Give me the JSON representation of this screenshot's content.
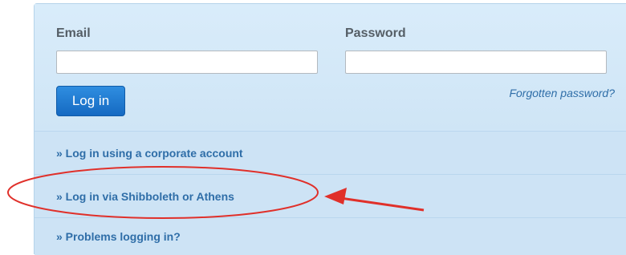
{
  "login": {
    "email_label": "Email",
    "password_label": "Password",
    "email_value": "",
    "password_value": "",
    "login_button": "Log in",
    "forgot_password": "Forgotten password?"
  },
  "options": [
    {
      "label": "» Log in using a corporate account"
    },
    {
      "label": "» Log in via Shibboleth or Athens"
    },
    {
      "label": "» Problems logging in?"
    }
  ],
  "colors": {
    "panel_background": "#d3e8f8",
    "button": "#1f7ad4",
    "link": "#2f6ea8",
    "annotation": "#e0302a"
  },
  "annotation": {
    "highlight_shape": "ellipse",
    "arrow": "pointing-left",
    "target": "Log in via Shibboleth or Athens"
  }
}
